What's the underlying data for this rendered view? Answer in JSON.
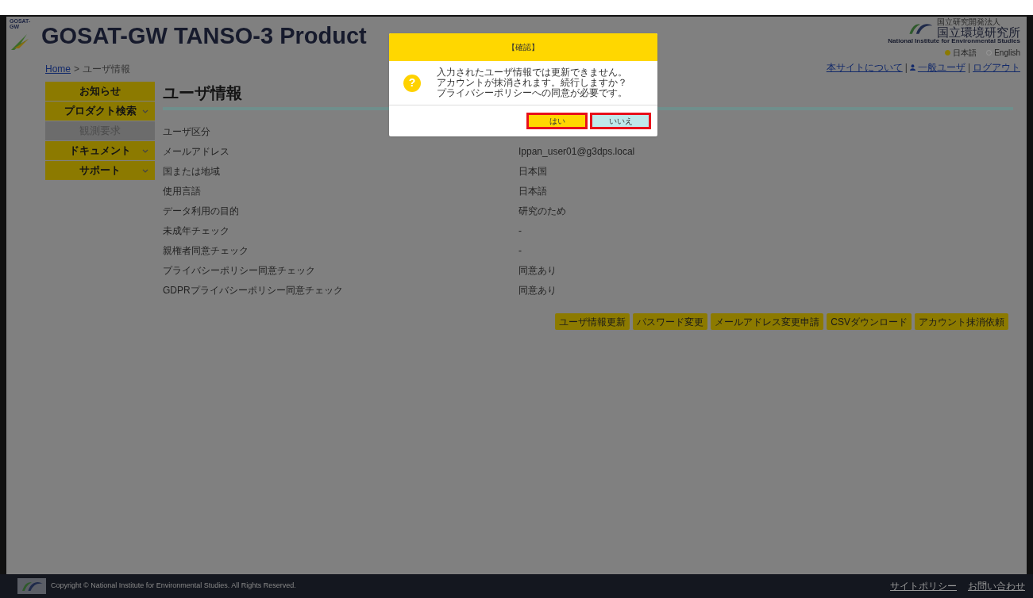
{
  "header": {
    "logo_caption": "GOSAT-GW",
    "title": "GOSAT-GW TANSO-3 Product",
    "org_small": "国立研究開発法人",
    "org_name": "国立環境研究所",
    "org_english": "National Institute for Environmental Studies",
    "languages": [
      {
        "label": "日本語",
        "selected": true
      },
      {
        "label": "English",
        "selected": false
      }
    ],
    "link_separator": "|",
    "links": [
      {
        "label": "本サイトについて",
        "kind": "link"
      },
      {
        "label": "一般ユーザ",
        "kind": "user"
      },
      {
        "label": "ログアウト",
        "kind": "link"
      }
    ]
  },
  "breadcrumb": {
    "home": "Home",
    "separator": ">",
    "current": "ユーザ情報"
  },
  "sidebar": {
    "items": [
      {
        "label": "お知らせ",
        "expandable": false,
        "disabled": false
      },
      {
        "label": "プロダクト検索",
        "expandable": true,
        "disabled": false
      },
      {
        "label": "観測要求",
        "expandable": false,
        "disabled": true
      },
      {
        "label": "ドキュメント",
        "expandable": true,
        "disabled": false
      },
      {
        "label": "サポート",
        "expandable": true,
        "disabled": false
      }
    ]
  },
  "page_title": "ユーザ情報",
  "rows": [
    {
      "label": "ユーザ区分"
    },
    {
      "label": "メールアドレス",
      "value": "Ippan_user01@g3dps.local"
    },
    {
      "label": "国または地域",
      "value": "日本国"
    },
    {
      "label": "使用言語",
      "value": "日本語"
    },
    {
      "label": "データ利用の目的",
      "value": "研究のため"
    },
    {
      "label": "未成年チェック",
      "value": "-"
    },
    {
      "label": "親権者同意チェック",
      "value": "-"
    },
    {
      "label": "プライバシーポリシー同意チェック",
      "value": "同意あり"
    },
    {
      "label": "GDPRプライバシーポリシー同意チェック",
      "value": "同意あり"
    }
  ],
  "actions": [
    "ユーザ情報更新",
    "パスワード変更",
    "メールアドレス変更申請",
    "CSVダウンロード",
    "アカウント抹消依頼"
  ],
  "dialog": {
    "title": "【確認】",
    "icon": "?",
    "lines": [
      "入力されたユーザ情報では更新できません。",
      "アカウントが抹消されます。続行しますか？",
      "プライバシーポリシーへの同意が必要です。"
    ],
    "buttons": [
      {
        "label": "はい",
        "kind": "primary",
        "highlighted": true
      },
      {
        "label": "いいえ",
        "kind": "secondary",
        "highlighted": true
      }
    ]
  },
  "footer": {
    "copyright": "Copyright © National Institute for Environmental Studies. All Rights Reserved.",
    "links": [
      "サイトポリシー",
      "お問い合わせ"
    ]
  }
}
